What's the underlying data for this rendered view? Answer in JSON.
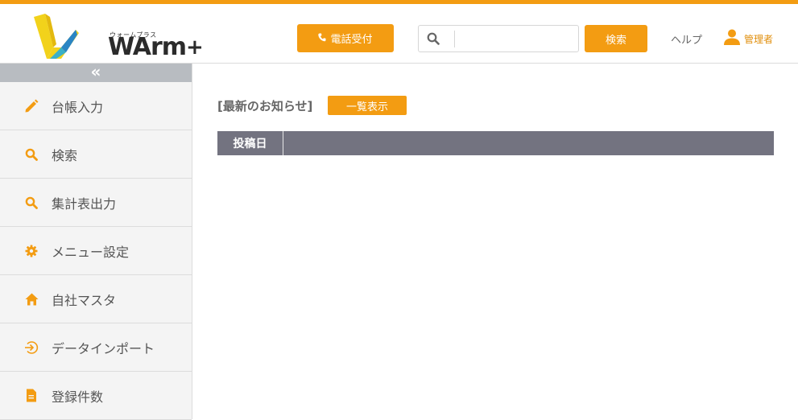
{
  "header": {
    "logo_kana": "ウォームプラス",
    "logo_word": "WArm",
    "logo_plus": "+",
    "phone_label": "電話受付",
    "search_placeholder": "",
    "search_value": "",
    "search_button": "検索",
    "help_label": "ヘルプ",
    "user_label": "管理者"
  },
  "sidebar": {
    "collapse_glyph": "«",
    "items": [
      {
        "label": "台帳入力",
        "icon": "pencil-icon"
      },
      {
        "label": "検索",
        "icon": "search-icon"
      },
      {
        "label": "集計表出力",
        "icon": "search-icon"
      },
      {
        "label": "メニュー設定",
        "icon": "gear-icon"
      },
      {
        "label": "自社マスタ",
        "icon": "home-icon"
      },
      {
        "label": "データインポート",
        "icon": "import-icon"
      },
      {
        "label": "登録件数",
        "icon": "document-icon"
      }
    ]
  },
  "main": {
    "news_title": "[最新のお知らせ]",
    "list_button": "一覧表示",
    "table_header_date": "投稿日",
    "table_header_content": ""
  },
  "colors": {
    "accent": "#f39c12",
    "table_header": "#737380",
    "sidebar_bg": "#f4f4f4",
    "collapse_bar": "#b8bcc1"
  }
}
